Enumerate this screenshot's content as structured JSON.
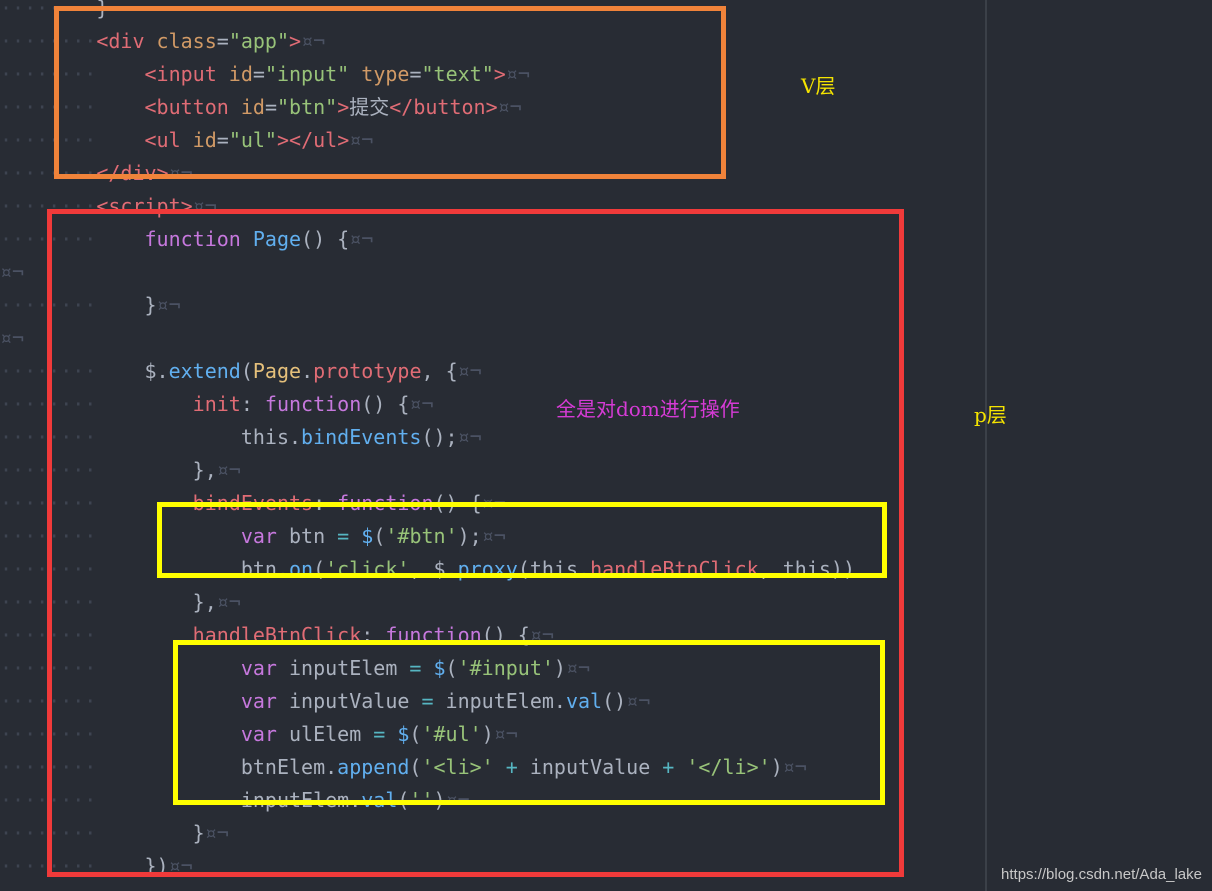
{
  "annotations": {
    "v_layer": "V层",
    "p_layer": "p层",
    "dom_note": "全是对dom进行操作"
  },
  "watermark": "https://blog.csdn.net/Ada_lake",
  "colors": {
    "background": "#282c34",
    "orange_box": "#f0833a",
    "red_box": "#f03a3a",
    "yellow_box": "#ffff00",
    "annotation_yellow": "#f5e400",
    "annotation_magenta": "#d63bd6"
  },
  "code_lines": [
    [
      [
        "guide",
        "········"
      ],
      [
        "punc",
        "}"
      ]
    ],
    [
      [
        "guide",
        "········"
      ],
      [
        "tag",
        "<div"
      ],
      [
        "txt",
        " "
      ],
      [
        "attr",
        "class"
      ],
      [
        "punc",
        "="
      ],
      [
        "str",
        "\"app\""
      ],
      [
        "tag",
        ">"
      ],
      [
        "inv",
        "¤¬"
      ]
    ],
    [
      [
        "guide",
        "········"
      ],
      [
        "txt",
        "    "
      ],
      [
        "tag",
        "<input"
      ],
      [
        "txt",
        " "
      ],
      [
        "attr",
        "id"
      ],
      [
        "punc",
        "="
      ],
      [
        "str",
        "\"input\""
      ],
      [
        "txt",
        " "
      ],
      [
        "attr",
        "type"
      ],
      [
        "punc",
        "="
      ],
      [
        "str",
        "\"text\""
      ],
      [
        "tag",
        ">"
      ],
      [
        "inv",
        "¤¬"
      ]
    ],
    [
      [
        "guide",
        "········"
      ],
      [
        "txt",
        "    "
      ],
      [
        "tag",
        "<button"
      ],
      [
        "txt",
        " "
      ],
      [
        "attr",
        "id"
      ],
      [
        "punc",
        "="
      ],
      [
        "str",
        "\"btn\""
      ],
      [
        "tag",
        ">"
      ],
      [
        "txt",
        "提交"
      ],
      [
        "tag",
        "</button>"
      ],
      [
        "inv",
        "¤¬"
      ]
    ],
    [
      [
        "guide",
        "········"
      ],
      [
        "txt",
        "    "
      ],
      [
        "tag",
        "<ul"
      ],
      [
        "txt",
        " "
      ],
      [
        "attr",
        "id"
      ],
      [
        "punc",
        "="
      ],
      [
        "str",
        "\"ul\""
      ],
      [
        "tag",
        "></ul>"
      ],
      [
        "inv",
        "¤¬"
      ]
    ],
    [
      [
        "guide",
        "········"
      ],
      [
        "tag",
        "</div>"
      ],
      [
        "inv",
        "¤¬"
      ]
    ],
    [
      [
        "guide",
        "········"
      ],
      [
        "tag",
        "<script>"
      ],
      [
        "inv",
        "¤¬"
      ]
    ],
    [
      [
        "guide",
        "········"
      ],
      [
        "txt",
        "    "
      ],
      [
        "kw",
        "function"
      ],
      [
        "txt",
        " "
      ],
      [
        "fn",
        "Page"
      ],
      [
        "punc",
        "() {"
      ],
      [
        "inv",
        "¤¬"
      ]
    ],
    [
      [
        "inv",
        "¤¬"
      ]
    ],
    [
      [
        "guide",
        "········"
      ],
      [
        "txt",
        "    "
      ],
      [
        "punc",
        "}"
      ],
      [
        "inv",
        "¤¬"
      ]
    ],
    [
      [
        "inv",
        "¤¬"
      ]
    ],
    [
      [
        "guide",
        "········"
      ],
      [
        "txt",
        "    "
      ],
      [
        "punc",
        "$."
      ],
      [
        "fn",
        "extend"
      ],
      [
        "punc",
        "("
      ],
      [
        "cls",
        "Page"
      ],
      [
        "punc",
        "."
      ],
      [
        "prop",
        "prototype"
      ],
      [
        "punc",
        ", {"
      ],
      [
        "inv",
        "¤¬"
      ]
    ],
    [
      [
        "guide",
        "········"
      ],
      [
        "txt",
        "        "
      ],
      [
        "prop",
        "init"
      ],
      [
        "punc",
        ": "
      ],
      [
        "kw",
        "function"
      ],
      [
        "punc",
        "() {"
      ],
      [
        "inv",
        "¤¬"
      ]
    ],
    [
      [
        "guide",
        "········"
      ],
      [
        "txt",
        "            "
      ],
      [
        "txt",
        "this."
      ],
      [
        "fn",
        "bindEvents"
      ],
      [
        "punc",
        "();"
      ],
      [
        "inv",
        "¤¬"
      ]
    ],
    [
      [
        "guide",
        "········"
      ],
      [
        "txt",
        "        "
      ],
      [
        "punc",
        "},"
      ],
      [
        "inv",
        "¤¬"
      ]
    ],
    [
      [
        "guide",
        "········"
      ],
      [
        "txt",
        "        "
      ],
      [
        "prop",
        "bindEvents"
      ],
      [
        "punc",
        ": "
      ],
      [
        "kw",
        "function"
      ],
      [
        "punc",
        "() {"
      ],
      [
        "inv",
        "¤¬"
      ]
    ],
    [
      [
        "guide",
        "········"
      ],
      [
        "txt",
        "            "
      ],
      [
        "kw",
        "var"
      ],
      [
        "txt",
        " btn "
      ],
      [
        "op",
        "="
      ],
      [
        "txt",
        " "
      ],
      [
        "fn",
        "$"
      ],
      [
        "punc",
        "("
      ],
      [
        "str",
        "'#btn'"
      ],
      [
        "punc",
        ");"
      ],
      [
        "inv",
        "¤¬"
      ]
    ],
    [
      [
        "guide",
        "········"
      ],
      [
        "txt",
        "            "
      ],
      [
        "txt",
        "btn."
      ],
      [
        "fn",
        "on"
      ],
      [
        "punc",
        "("
      ],
      [
        "str",
        "'click'"
      ],
      [
        "punc",
        ", $."
      ],
      [
        "fn",
        "proxy"
      ],
      [
        "punc",
        "(this."
      ],
      [
        "prop",
        "handleBtnClick"
      ],
      [
        "punc",
        ", this))"
      ]
    ],
    [
      [
        "guide",
        "········"
      ],
      [
        "txt",
        "        "
      ],
      [
        "punc",
        "},"
      ],
      [
        "inv",
        "¤¬"
      ]
    ],
    [
      [
        "guide",
        "········"
      ],
      [
        "txt",
        "        "
      ],
      [
        "prop",
        "handleBtnClick"
      ],
      [
        "punc",
        ": "
      ],
      [
        "kw",
        "function"
      ],
      [
        "punc",
        "() {"
      ],
      [
        "inv",
        "¤¬"
      ]
    ],
    [
      [
        "guide",
        "········"
      ],
      [
        "txt",
        "            "
      ],
      [
        "kw",
        "var"
      ],
      [
        "txt",
        " inputElem "
      ],
      [
        "op",
        "="
      ],
      [
        "txt",
        " "
      ],
      [
        "fn",
        "$"
      ],
      [
        "punc",
        "("
      ],
      [
        "str",
        "'#input'"
      ],
      [
        "punc",
        ")"
      ],
      [
        "inv",
        "¤¬"
      ]
    ],
    [
      [
        "guide",
        "········"
      ],
      [
        "txt",
        "            "
      ],
      [
        "kw",
        "var"
      ],
      [
        "txt",
        " inputValue "
      ],
      [
        "op",
        "="
      ],
      [
        "txt",
        " inputElem."
      ],
      [
        "fn",
        "val"
      ],
      [
        "punc",
        "()"
      ],
      [
        "inv",
        "¤¬"
      ]
    ],
    [
      [
        "guide",
        "········"
      ],
      [
        "txt",
        "            "
      ],
      [
        "kw",
        "var"
      ],
      [
        "txt",
        " ulElem "
      ],
      [
        "op",
        "="
      ],
      [
        "txt",
        " "
      ],
      [
        "fn",
        "$"
      ],
      [
        "punc",
        "("
      ],
      [
        "str",
        "'#ul'"
      ],
      [
        "punc",
        ")"
      ],
      [
        "inv",
        "¤¬"
      ]
    ],
    [
      [
        "guide",
        "········"
      ],
      [
        "txt",
        "            "
      ],
      [
        "txt",
        "btnElem."
      ],
      [
        "fn",
        "append"
      ],
      [
        "punc",
        "("
      ],
      [
        "str",
        "'<li>'"
      ],
      [
        "txt",
        " "
      ],
      [
        "op",
        "+"
      ],
      [
        "txt",
        " inputValue "
      ],
      [
        "op",
        "+"
      ],
      [
        "txt",
        " "
      ],
      [
        "str",
        "'</li>'"
      ],
      [
        "punc",
        ")"
      ],
      [
        "inv",
        "¤¬"
      ]
    ],
    [
      [
        "guide",
        "········"
      ],
      [
        "txt",
        "            "
      ],
      [
        "txt",
        "inputElem."
      ],
      [
        "fn",
        "val"
      ],
      [
        "punc",
        "("
      ],
      [
        "str",
        "''"
      ],
      [
        "punc",
        ")"
      ],
      [
        "inv",
        "¤¬"
      ]
    ],
    [
      [
        "guide",
        "········"
      ],
      [
        "txt",
        "        "
      ],
      [
        "punc",
        "}"
      ],
      [
        "inv",
        "¤¬"
      ]
    ],
    [
      [
        "guide",
        "········"
      ],
      [
        "txt",
        "    "
      ],
      [
        "punc",
        "})"
      ],
      [
        "inv",
        "¤¬"
      ]
    ]
  ]
}
